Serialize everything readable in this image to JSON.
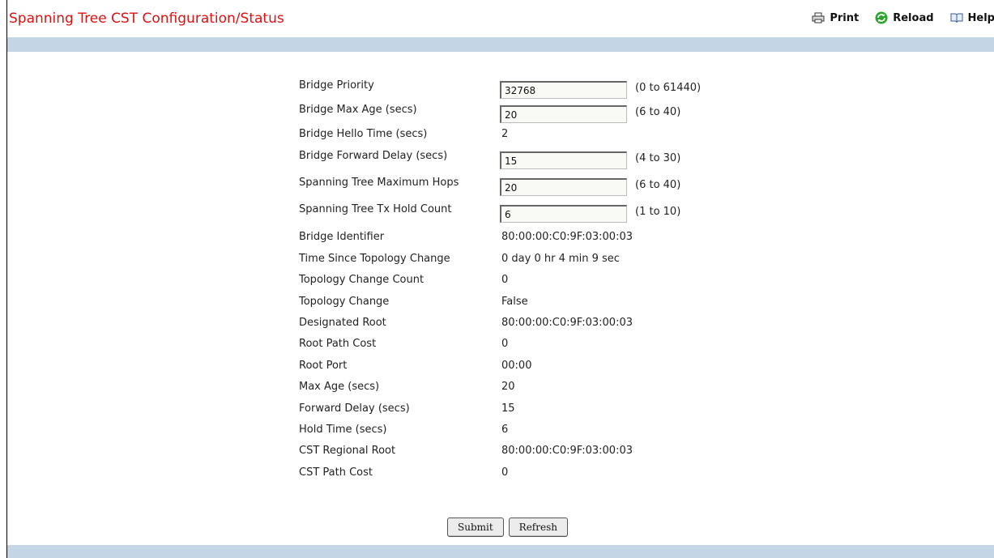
{
  "page": {
    "title": "Spanning Tree CST Configuration/Status"
  },
  "toolbar": {
    "print_label": "Print",
    "reload_label": "Reload",
    "help_label": "Help",
    "print_icon": "printer-icon",
    "reload_icon": "reload-icon",
    "help_icon": "book-icon"
  },
  "fields": {
    "bridge_priority": {
      "label": "Bridge Priority",
      "value": "32768",
      "range": "(0 to 61440)"
    },
    "bridge_max_age": {
      "label": "Bridge Max Age (secs)",
      "value": "20",
      "range": "(6 to 40)"
    },
    "bridge_hello_time": {
      "label": "Bridge Hello Time (secs)",
      "value": "2"
    },
    "bridge_forward_delay": {
      "label": "Bridge Forward Delay (secs)",
      "value": "15",
      "range": "(4 to 30)"
    },
    "max_hops": {
      "label": "Spanning Tree Maximum Hops",
      "value": "20",
      "range": "(6 to 40)"
    },
    "tx_hold_count": {
      "label": "Spanning Tree Tx Hold Count",
      "value": "6",
      "range": "(1 to 10)"
    },
    "bridge_identifier": {
      "label": "Bridge Identifier",
      "value": "80:00:00:C0:9F:03:00:03"
    },
    "time_since_topology_change": {
      "label": "Time Since Topology Change",
      "value": "0 day 0 hr 4 min 9 sec"
    },
    "topology_change_count": {
      "label": "Topology Change Count",
      "value": "0"
    },
    "topology_change": {
      "label": "Topology Change",
      "value": "False"
    },
    "designated_root": {
      "label": "Designated Root",
      "value": "80:00:00:C0:9F:03:00:03"
    },
    "root_path_cost": {
      "label": "Root Path Cost",
      "value": "0"
    },
    "root_port": {
      "label": "Root Port",
      "value": "00:00"
    },
    "max_age": {
      "label": "Max Age (secs)",
      "value": "20"
    },
    "forward_delay": {
      "label": "Forward Delay (secs)",
      "value": "15"
    },
    "hold_time": {
      "label": "Hold Time (secs)",
      "value": "6"
    },
    "cst_regional_root": {
      "label": "CST Regional Root",
      "value": "80:00:00:C0:9F:03:00:03"
    },
    "cst_path_cost": {
      "label": "CST Path Cost",
      "value": "0"
    }
  },
  "buttons": {
    "submit_label": "Submit",
    "refresh_label": "Refresh"
  },
  "colors": {
    "title": "#e01010",
    "bar": "#c4d6e6"
  }
}
